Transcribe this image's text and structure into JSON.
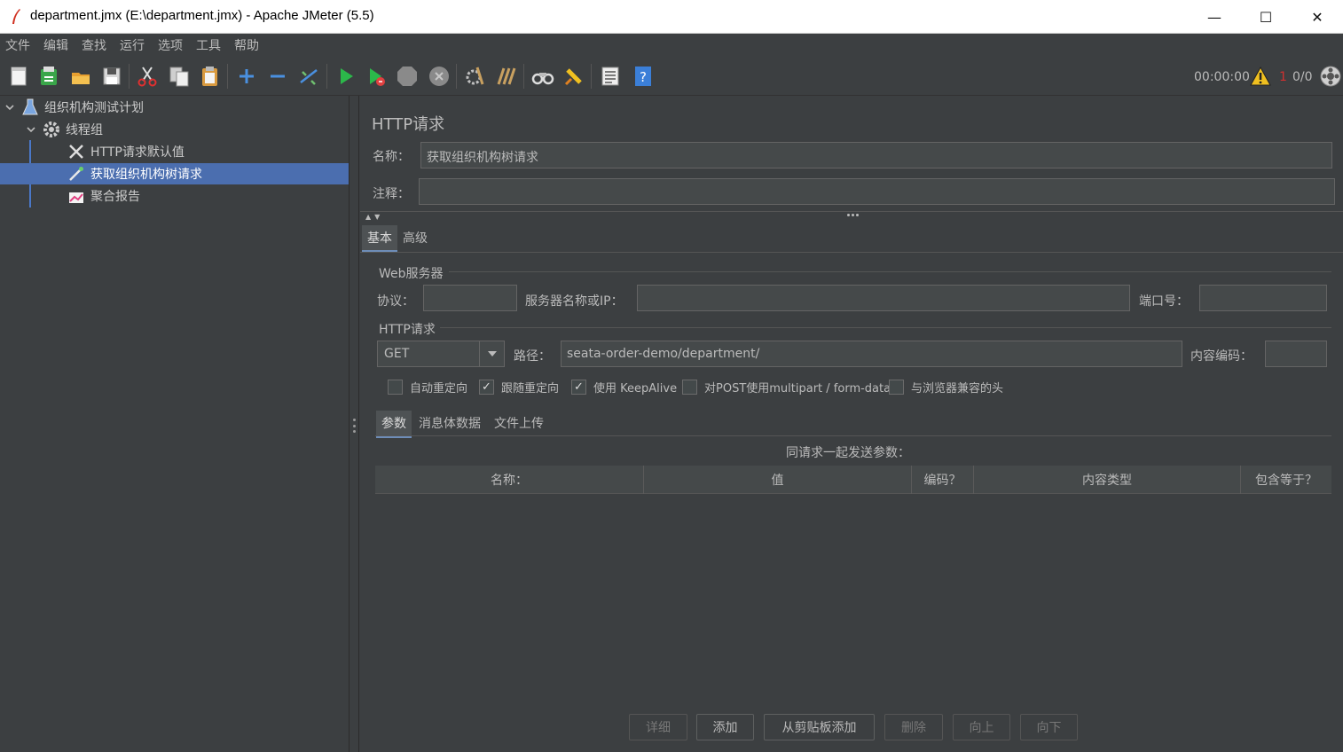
{
  "window": {
    "title": "department.jmx (E:\\department.jmx) - Apache JMeter (5.5)",
    "minimize": "—",
    "maximize": "☐",
    "close": "✕"
  },
  "menu": [
    "文件",
    "编辑",
    "查找",
    "运行",
    "选项",
    "工具",
    "帮助"
  ],
  "toolbar": {
    "icons": [
      "new-icon",
      "templates-icon",
      "open-icon",
      "save-icon",
      "cut-icon",
      "copy-icon",
      "paste-icon",
      "expand-icon",
      "collapse-icon",
      "toggle-icon",
      "start-icon",
      "start-no-pause-icon",
      "stop-icon",
      "shutdown-icon",
      "clear-icon",
      "clear-all-icon",
      "search-icon",
      "reset-search-icon",
      "function-helper-icon",
      "help-icon"
    ],
    "timer": "00:00:00",
    "error_count": "1",
    "threads": "0/0",
    "warning_color": "#f0c020"
  },
  "tree": {
    "plan": "组织机构测试计划",
    "thread_group": "线程组",
    "defaults": "HTTP请求默认值",
    "request": "获取组织机构树请求",
    "report": "聚合报告"
  },
  "panel": {
    "title": "HTTP请求",
    "name_label": "名称：",
    "name_value": "获取组织机构树请求",
    "comment_label": "注释：",
    "comment_value": "",
    "tabs": [
      "基本",
      "高级"
    ],
    "web_server": {
      "legend": "Web服务器",
      "protocol_label": "协议：",
      "protocol_value": "",
      "server_label": "服务器名称或IP：",
      "server_value": "",
      "port_label": "端口号：",
      "port_value": ""
    },
    "http_request": {
      "legend": "HTTP请求",
      "method": "GET",
      "path_label": "路径：",
      "path_value": "seata-order-demo/department/",
      "encoding_label": "内容编码：",
      "encoding_value": ""
    },
    "options": [
      {
        "label": "自动重定向",
        "checked": false
      },
      {
        "label": "跟随重定向",
        "checked": true
      },
      {
        "label": "使用 KeepAlive",
        "checked": true
      },
      {
        "label": "对POST使用multipart / form-data",
        "checked": false
      },
      {
        "label": "与浏览器兼容的头",
        "checked": false
      }
    ],
    "sub_tabs": [
      "参数",
      "消息体数据",
      "文件上传"
    ],
    "params_caption": "同请求一起发送参数：",
    "columns": [
      "名称：",
      "值",
      "编码？",
      "内容类型",
      "包含等于？"
    ],
    "buttons": {
      "detail": "详细",
      "add": "添加",
      "add_clipboard": "从剪贴板添加",
      "delete": "删除",
      "up": "向上",
      "down": "向下"
    }
  },
  "colors": {
    "background": "#3c3f41",
    "selection": "#4b6eaf",
    "field": "#45494a"
  }
}
